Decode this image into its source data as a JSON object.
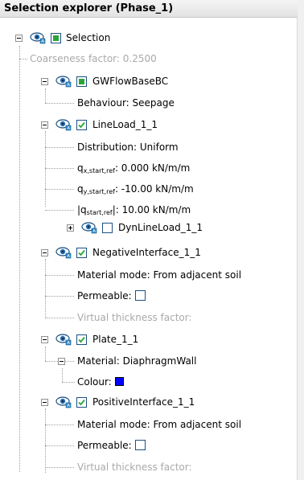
{
  "panel": {
    "title": "Selection explorer (Phase_1)"
  },
  "tree": {
    "selection": {
      "label": "Selection",
      "coarseness": "Coarseness factor: 0.2500"
    },
    "gwflow": {
      "label": "GWFlowBaseBC",
      "behaviour": "Behaviour: Seepage"
    },
    "lineload": {
      "label": "LineLoad_1_1",
      "distribution": "Distribution: Uniform",
      "qx_main": "q",
      "qx_sub": "x,start,ref",
      "qx_value": ": 0.000 kN/m/m",
      "qy_main": "q",
      "qy_sub": "y,start,ref",
      "qy_value": ": -10.00 kN/m/m",
      "qabs_main": "|q",
      "qabs_sub": "start,ref",
      "qabs_value": "|: 10.00 kN/m/m",
      "dyn": "DynLineLoad_1_1"
    },
    "neg": {
      "label": "NegativeInterface_1_1",
      "material": "Material mode: From adjacent soil",
      "permeable": "Permeable:",
      "virtual": "Virtual thickness factor:"
    },
    "plate": {
      "label": "Plate_1_1",
      "material": "Material: DiaphragmWall",
      "colour": "Colour:",
      "colour_value": "#0000ff"
    },
    "pos": {
      "label": "PositiveInterface_1_1",
      "material": "Material mode: From adjacent soil",
      "permeable": "Permeable:",
      "virtual": "Virtual thickness factor:"
    }
  },
  "icons": {
    "eye": "eye-icon",
    "expander": "expander-icon",
    "checkbox": "checkbox-icon"
  },
  "colors": {
    "check_green": "#2aa538",
    "checkbox_border": "#1c5180",
    "disabled_text": "#a9a9a9"
  }
}
